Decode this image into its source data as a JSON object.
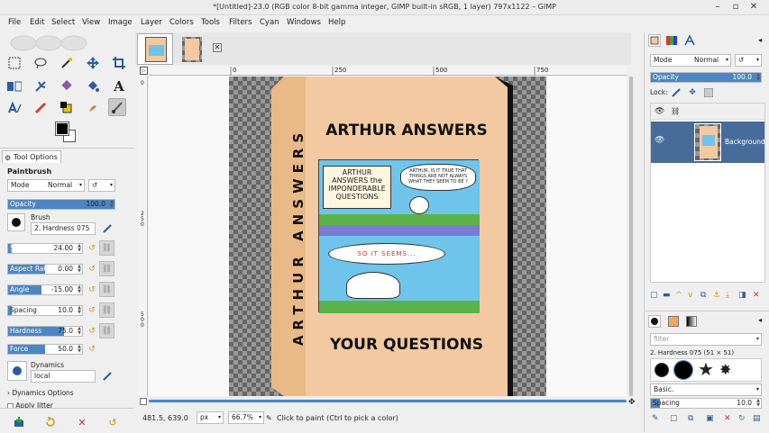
{
  "window": {
    "title": "*[Untitled]-23.0 (RGB color 8-bit gamma integer, GIMP built-in sRGB, 1 layer) 797x1122 – GIMP"
  },
  "menu": [
    "File",
    "Edit",
    "Select",
    "View",
    "Image",
    "Layer",
    "Colors",
    "Tools",
    "Filters",
    "Cyan",
    "Windows",
    "Help"
  ],
  "tool_options": {
    "tab_label": "Tool Options",
    "tool_name": "Paintbrush",
    "mode_label": "Mode",
    "mode_value": "Normal",
    "opacity": {
      "label": "Opacity",
      "value": "100.0",
      "fraction": 1.0
    },
    "brush_label": "Brush",
    "brush_name": "2. Hardness 075",
    "size": {
      "label": "Size",
      "value": "24.00",
      "fraction": 0.05
    },
    "aspect": {
      "label": "Aspect Ratio",
      "value": "0.00",
      "fraction": 0.5
    },
    "angle": {
      "label": "Angle",
      "value": "-15.00",
      "fraction": 0.45
    },
    "spacing": {
      "label": "Spacing",
      "value": "10.0",
      "fraction": 0.05
    },
    "hardness": {
      "label": "Hardness",
      "value": "75.0",
      "fraction": 0.75
    },
    "force": {
      "label": "Force",
      "value": "50.0",
      "fraction": 0.5
    },
    "dynamics_label": "Dynamics",
    "dynamics_value": "local",
    "dynamics_options": "Dynamics Options",
    "apply_jitter": "Apply Jitter"
  },
  "canvas": {
    "ruler_marks": [
      "0",
      "250",
      "500",
      "750"
    ],
    "vruler_marks": [
      "0",
      "2\n5\n0",
      "5\n0\n0",
      "7\n5\n0"
    ],
    "box": {
      "title_top": "ARTHUR ANSWERS",
      "title_bottom": "YOUR QUESTIONS",
      "spine": "ARTHUR ANSWERS",
      "comic": {
        "sign": "ARTHUR ANSWERS the IMPONDERABLE QUESTIONS",
        "bubble_top": "ARTHUR, IS IT TRUE THAT THINGS ARE NOT ALWAYS WHAT THEY SEEM TO BE ?",
        "bubble_bottom": "SO IT SEEMS..."
      }
    }
  },
  "statusbar": {
    "coords": "481.5, 639.0",
    "unit": "px",
    "zoom": "66.7%",
    "message": "Click to paint (Ctrl to pick a color)"
  },
  "layers": {
    "mode_label": "Mode",
    "mode_value": "Normal",
    "opacity_label": "Opacity",
    "opacity_value": "100.0",
    "lock_label": "Lock:",
    "layer_name": "Background"
  },
  "brushes": {
    "filter_placeholder": "filter",
    "brush_name": "2. Hardness 075 (51 × 51)",
    "preset": "Basic.",
    "spacing_label": "Spacing",
    "spacing_value": "10.0"
  },
  "colors": {
    "accent": "#4d86c2",
    "layer_row": "#476c9a",
    "box_face": "#f2c9a0"
  }
}
